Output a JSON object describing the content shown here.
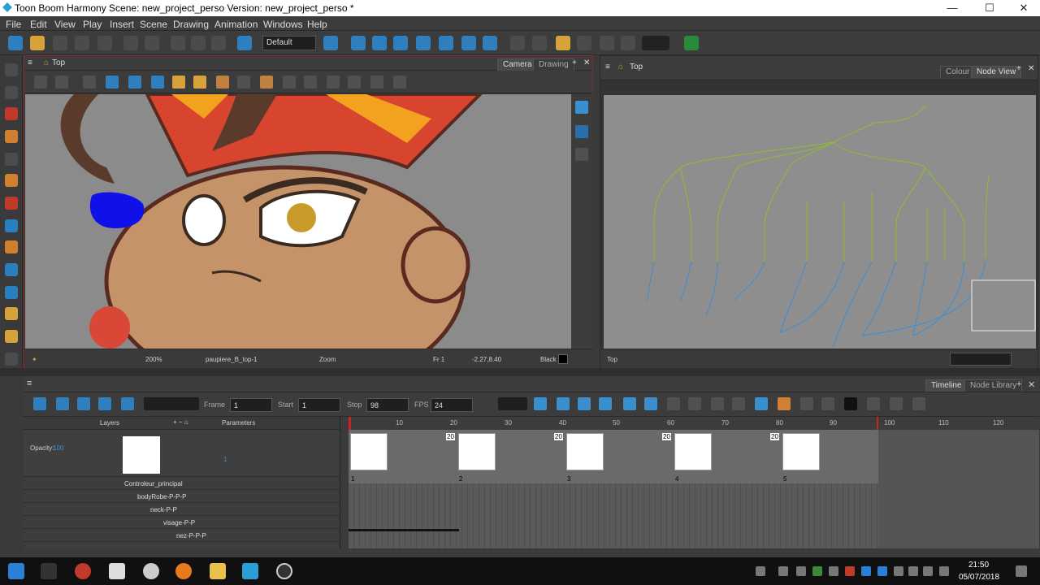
{
  "window": {
    "title": "Toon Boom Harmony Scene: new_project_perso Version: new_project_perso *",
    "minimize": "—",
    "maximize": "☐",
    "close": "✕"
  },
  "menu": [
    "File",
    "Edit",
    "View",
    "Play",
    "Insert",
    "Scene",
    "Drawing",
    "Animation",
    "Windows",
    "Help"
  ],
  "toolbar": {
    "preset": "Default"
  },
  "camera": {
    "top_label": "Top",
    "tab_camera": "Camera",
    "tab_drawing": "Drawing",
    "zoom": "200%",
    "layer_name": "paupiere_B_top-1",
    "zoom_label": "Zoom",
    "frame": "Fr 1",
    "coords": "-2.27,8.40",
    "color_name": "Black"
  },
  "nodeview": {
    "top_label": "Top",
    "tab_colour": "Colour",
    "tab_node": "Node View",
    "status_label": "Top"
  },
  "timeline": {
    "tab_timeline": "Timeline",
    "tab_library": "Node Library",
    "frame_label": "Frame",
    "frame_value": "1",
    "start_label": "Start",
    "start_value": "1",
    "stop_label": "Stop",
    "stop_value": "98",
    "fps_label": "FPS",
    "fps_value": "24",
    "layers_header": "Layers",
    "params_header": "Parameters",
    "opacity_label": "Opacity:",
    "opacity_value": "100",
    "selected_layer_value": "1",
    "layers": [
      "Controleur_principal",
      "bodyRobe-P-P-P",
      "neck-P-P",
      "visage-P-P",
      "nez-P-P-P"
    ],
    "ruler": [
      "10",
      "20",
      "30",
      "40",
      "50",
      "60",
      "70",
      "80",
      "90",
      "100",
      "110",
      "120"
    ],
    "thumb_numbers": [
      "1",
      "2",
      "3",
      "4",
      "5"
    ],
    "thumb_badges": [
      "20",
      "20",
      "20",
      "20"
    ]
  },
  "taskbar": {
    "time": "21:50",
    "date": "05/07/2018"
  }
}
